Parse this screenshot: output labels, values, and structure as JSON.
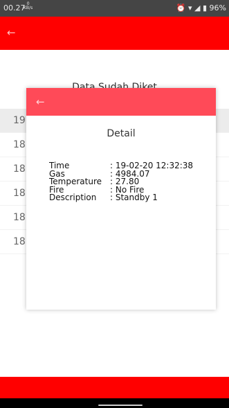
{
  "status": {
    "time": "00.27",
    "net_speed": "0",
    "net_unit": "KB/s",
    "icons": "alarm-icon wifi-icon signal-icon signal-icon battery-icon",
    "battery": "96%"
  },
  "appbar": {
    "back_icon": "arrow-left-icon",
    "color": "#ff0000"
  },
  "page_title": "Data Sudah Diket",
  "list": {
    "items": [
      "19",
      "18",
      "18",
      "18",
      "18",
      "18"
    ]
  },
  "dialog": {
    "bar_color": "#ff4a58",
    "title": "Detail",
    "fields": [
      {
        "label": "Time",
        "value": ": 19-02-20 12:32:38"
      },
      {
        "label": "Gas",
        "value": ": 4984.07"
      },
      {
        "label": "Temperature",
        "value": ": 27.80"
      },
      {
        "label": "Fire",
        "value": ": No Fire"
      },
      {
        "label": "Description",
        "value": ": Standby 1"
      }
    ]
  }
}
